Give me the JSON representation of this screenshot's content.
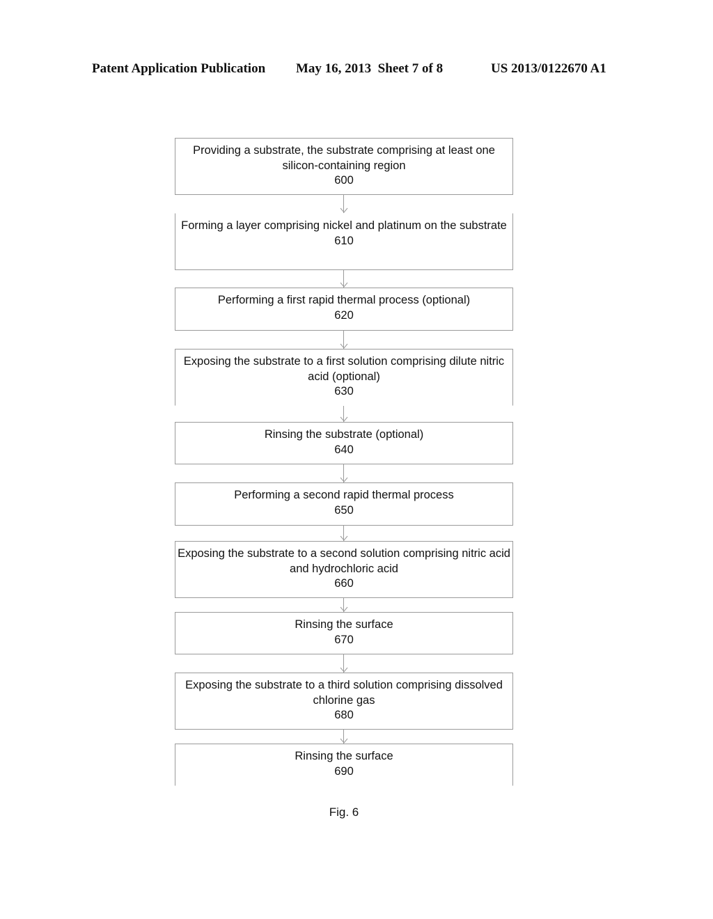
{
  "header": {
    "left": "Patent Application Publication",
    "center": "May 16, 2013  Sheet 7 of 8",
    "right": "US 2013/0122670 A1"
  },
  "steps": [
    {
      "text": "Providing a substrate, the substrate comprising at least one silicon-containing region",
      "number": "600"
    },
    {
      "text": "Forming a layer comprising nickel and platinum on the substrate",
      "number": "610"
    },
    {
      "text": "Performing a first rapid thermal process (optional)",
      "number": "620"
    },
    {
      "text": "Exposing the substrate to a first solution comprising dilute nitric acid (optional)",
      "number": "630"
    },
    {
      "text": "Rinsing the substrate (optional)",
      "number": "640"
    },
    {
      "text": "Performing a second rapid thermal process",
      "number": "650"
    },
    {
      "text": "Exposing the substrate to a second solution comprising nitric acid and hydrochloric acid",
      "number": "660"
    },
    {
      "text": "Rinsing the surface",
      "number": "670"
    },
    {
      "text": "Exposing the substrate to a third solution comprising dissolved chlorine gas",
      "number": "680"
    },
    {
      "text": "Rinsing the surface",
      "number": "690"
    }
  ],
  "figure_label": "Fig. 6"
}
